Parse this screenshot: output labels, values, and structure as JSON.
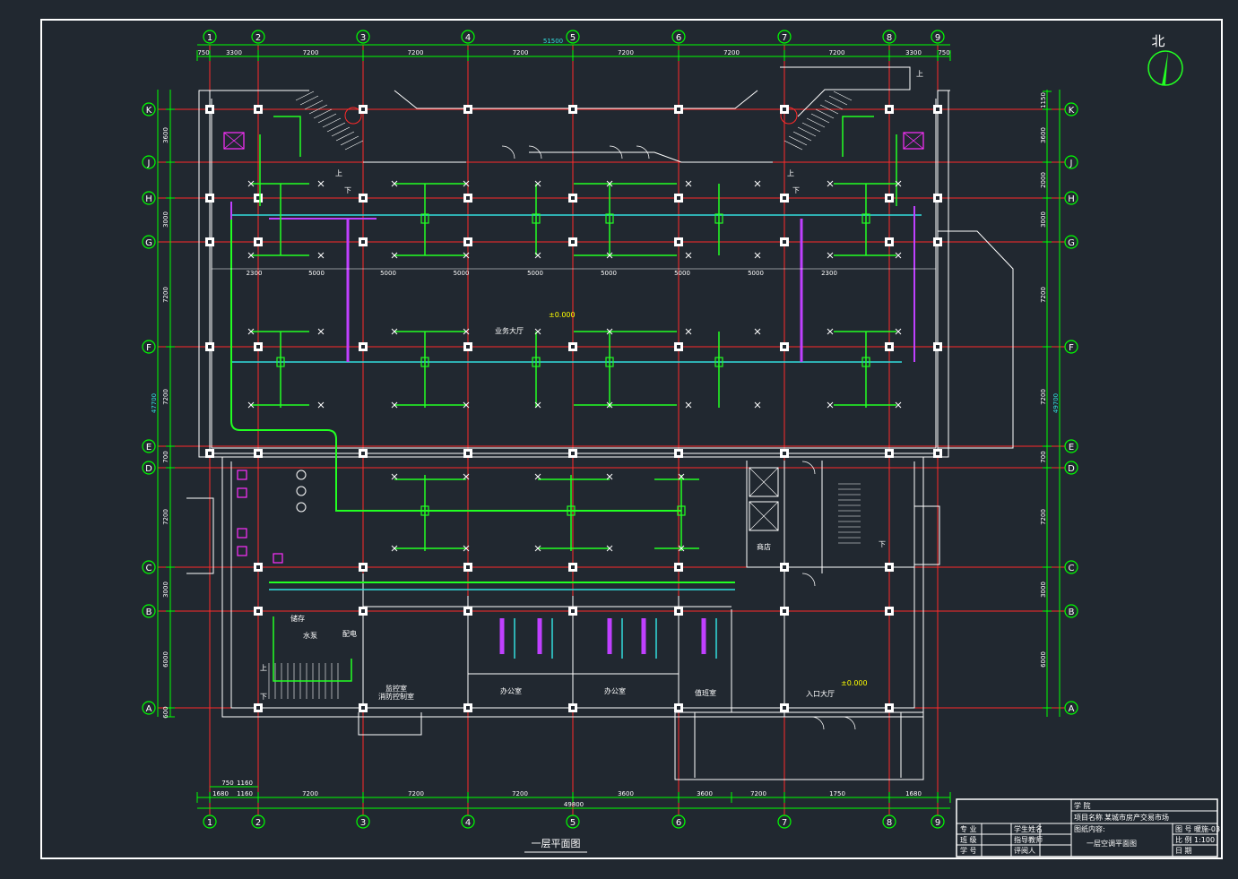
{
  "colors": {
    "background": "#212830",
    "frame": "#ffffff",
    "axis": "#ff2a2a",
    "dimension": "#00ff00",
    "duct_green": "#22ff22",
    "duct_cyan": "#33dddd",
    "duct_purple": "#c040ff",
    "wall": "#ffffff",
    "elevation": "#ffff00"
  },
  "north": {
    "label": "北"
  },
  "grid": {
    "columns": [
      "1",
      "2",
      "3",
      "4",
      "5",
      "6",
      "7",
      "8",
      "9"
    ],
    "rows": [
      "K",
      "J",
      "H",
      "G",
      "F",
      "E",
      "D",
      "C",
      "B",
      "A"
    ]
  },
  "dimensions": {
    "top_total": "51500",
    "top_segments": [
      "750",
      "3300",
      "7200",
      "7200",
      "7200",
      "7200",
      "7200",
      "7200",
      "3300",
      "750"
    ],
    "bottom_total": "49800",
    "bottom_segments": [
      "1680",
      "1160",
      "7200",
      "7200",
      "7200",
      "3600",
      "3600",
      "7200",
      "1750",
      "1680"
    ],
    "bottom_small": [
      "750",
      "1160"
    ],
    "left_segments": [
      "3600",
      "3000",
      "7200",
      "7200",
      "700",
      "7200",
      "3000",
      "6000",
      "600"
    ],
    "left_total": "47700",
    "right_segments": [
      "1150",
      "3600",
      "2000",
      "3000",
      "7200",
      "7200",
      "700",
      "7200",
      "3000",
      "6000"
    ],
    "right_total": "49700",
    "duct_spacing": [
      "2300",
      "5000",
      "5000",
      "5000",
      "5000",
      "5000",
      "5000",
      "5000",
      "2300"
    ]
  },
  "rooms": {
    "hall": "业务大厅",
    "hall_elev": "±0.000",
    "entrance": "入口大厅",
    "entrance_elev": "±0.000",
    "office1": "办公室",
    "office2": "办公室",
    "duty": "值班室",
    "control": "监控室",
    "control2": "消防控制室",
    "storage": "储存",
    "water": "水泵",
    "electric": "配电",
    "shop": "商店",
    "up": "上",
    "down": "下"
  },
  "drawing_title": "一层平面图",
  "title_block": {
    "school": "学 院",
    "project_label": "项目名称",
    "project_name": "某城市房产交易市场",
    "content_label": "图纸内容:",
    "content": "一层空调平面图",
    "major": "专 业",
    "class": "班 级",
    "student_no": "学 号",
    "student_name": "学生姓名",
    "advisor": "指导教师",
    "reviewer": "评阅人",
    "drawing_no_label": "图 号",
    "drawing_no": "暖施-03",
    "scale_label": "比 例",
    "scale": "1:100",
    "date_label": "日 期"
  }
}
